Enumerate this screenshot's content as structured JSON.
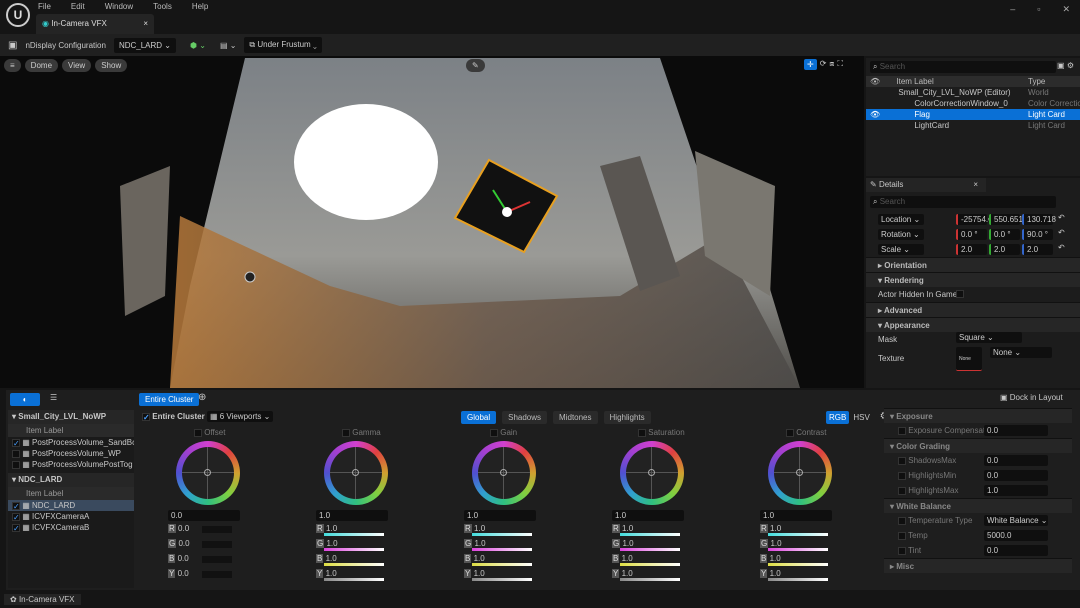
{
  "menu": {
    "items": [
      "File",
      "Edit",
      "Window",
      "Tools",
      "Help"
    ],
    "tab": "In-Camera VFX",
    "tab_close": "×",
    "window_controls": [
      "–",
      "▫",
      "✕"
    ]
  },
  "toolbar": {
    "config_label": "nDisplay Configuration",
    "config_value": "NDC_LARD",
    "frustum": "Under Frustum"
  },
  "viewport": {
    "buttons": [
      "Dome",
      "View",
      "Show"
    ]
  },
  "outliner": {
    "search_placeholder": "Search",
    "col_label": "Item Label",
    "col_type": "Type",
    "rows": [
      {
        "label": "Small_City_LVL_NoWP (Editor)",
        "type": "World",
        "indent": 1,
        "selected": false
      },
      {
        "label": "ColorCorrectionWindow_0",
        "type": "Color Correctio",
        "indent": 2,
        "selected": false
      },
      {
        "label": "Flag",
        "type": "Light Card",
        "indent": 2,
        "selected": true
      },
      {
        "label": "LightCard",
        "type": "Light Card",
        "indent": 2,
        "selected": false
      }
    ]
  },
  "details": {
    "title": "Details",
    "close": "×",
    "search_placeholder": "Search",
    "transform": [
      {
        "label": "Location",
        "x": "-25754.€",
        "y": "550.651(",
        "z": "130.718"
      },
      {
        "label": "Rotation",
        "x": "0.0 °",
        "y": "0.0 °",
        "z": "90.0 °"
      },
      {
        "label": "Scale",
        "x": "2.0",
        "y": "2.0",
        "z": "2.0"
      }
    ],
    "sections": {
      "orientation": "Orientation",
      "rendering": "Rendering",
      "actor_hidden": "Actor Hidden In Game",
      "advanced": "Advanced",
      "appearance": "Appearance",
      "mask": "Mask",
      "mask_value": "Square",
      "texture": "Texture",
      "texture_value": "None",
      "texture_thumb": "None"
    }
  },
  "bottom": {
    "entire_cluster_btn": "Entire Cluster",
    "entire_cluster": "Entire Cluster",
    "viewports": "6 Viewports",
    "dock": "Dock in Layout",
    "tabs": [
      "Global",
      "Shadows",
      "Midtones",
      "Highlights"
    ],
    "active_tab": "Global",
    "modes": [
      "RGB",
      "HSV"
    ],
    "groups": [
      {
        "title": "Small_City_LVL_NoWP",
        "header": "Item Label",
        "items": [
          {
            "label": "PostProcessVolume_SandBc",
            "checked": true
          },
          {
            "label": "PostProcessVolume_WP",
            "checked": false
          },
          {
            "label": "PostProcessVolumePostTog",
            "checked": false
          }
        ]
      },
      {
        "title": "NDC_LARD",
        "header": "Item Label",
        "items": [
          {
            "label": "NDC_LARD",
            "checked": true,
            "selected": true
          },
          {
            "label": "ICVFXCameraA",
            "checked": true
          },
          {
            "label": "ICVFXCameraB",
            "checked": true
          }
        ]
      }
    ],
    "wheels": [
      {
        "label": "Offset",
        "value": "0.0",
        "r": "0.0",
        "g": "0.0",
        "b": "0.0",
        "y": "0.0"
      },
      {
        "label": "Gamma",
        "value": "1.0",
        "r": "1.0",
        "g": "1.0",
        "b": "1.0",
        "y": "1.0"
      },
      {
        "label": "Gain",
        "value": "1.0",
        "r": "1.0",
        "g": "1.0",
        "b": "1.0",
        "y": "1.0"
      },
      {
        "label": "Saturation",
        "value": "1.0",
        "r": "1.0",
        "g": "1.0",
        "b": "1.0",
        "y": "1.0"
      },
      {
        "label": "Contrast",
        "value": "1.0",
        "r": "1.0",
        "g": "1.0",
        "b": "1.0",
        "y": "1.0"
      }
    ],
    "channel_letters": [
      "R",
      "G",
      "B",
      "Y"
    ],
    "props": [
      {
        "section": "Exposure",
        "rows": [
          {
            "label": "Exposure Compensati",
            "value": "0.0"
          }
        ]
      },
      {
        "section": "Color Grading",
        "rows": [
          {
            "label": "ShadowsMax",
            "value": "0.0"
          },
          {
            "label": "HighlightsMin",
            "value": "0.0"
          },
          {
            "label": "HighlightsMax",
            "value": "1.0"
          }
        ]
      },
      {
        "section": "White Balance",
        "rows": [
          {
            "label": "Temperature Type",
            "value": "White Balance ⌄"
          },
          {
            "label": "Temp",
            "value": "5000.0"
          },
          {
            "label": "Tint",
            "value": "0.0"
          }
        ]
      },
      {
        "section": "Misc",
        "rows": []
      }
    ]
  },
  "statusbar": {
    "tab": "In-Camera VFX"
  },
  "colors": {
    "accent": "#0a70d6",
    "selection": "#0a70d6"
  }
}
